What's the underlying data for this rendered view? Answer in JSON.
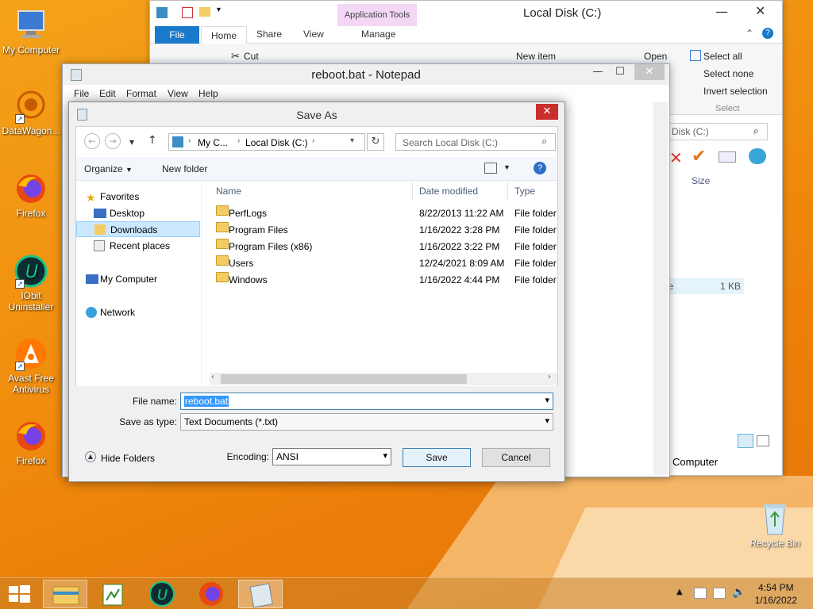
{
  "desktop": {
    "icons": [
      {
        "label": "My Computer"
      },
      {
        "label": "DataWagon..."
      },
      {
        "label": "Firefox"
      },
      {
        "label": "IObit Uninstaller"
      },
      {
        "label": "Avast Free Antivirus"
      },
      {
        "label": "Firefox"
      }
    ],
    "recycle_bin": "Recycle Bin"
  },
  "explorer": {
    "title": "Local Disk (C:)",
    "context_tab": "Application Tools",
    "tabs": [
      "File",
      "Home",
      "Share",
      "View",
      "Manage"
    ],
    "ribbon": {
      "cut": "Cut",
      "new_item": "New item",
      "open": "Open",
      "select_all": "Select all",
      "select_none": "Select none",
      "invert_selection": "Invert selection",
      "select_group": "Select"
    },
    "search_fragment": "Disk (C:)",
    "size_header": "Size",
    "size_value": "1 KB",
    "name_fragment": "le",
    "status_fragment": "Computer"
  },
  "notepad": {
    "title": "reboot.bat - Notepad",
    "menu": [
      "File",
      "Edit",
      "Format",
      "View",
      "Help"
    ]
  },
  "saveas": {
    "title": "Save As",
    "breadcrumb": [
      "My C...",
      "Local Disk (C:)"
    ],
    "search_placeholder": "Search Local Disk (C:)",
    "organize": "Organize",
    "new_folder": "New folder",
    "nav": {
      "favorites": "Favorites",
      "desktop": "Desktop",
      "downloads": "Downloads",
      "recent": "Recent places",
      "computer": "My Computer",
      "network": "Network"
    },
    "columns": [
      "Name",
      "Date modified",
      "Type"
    ],
    "files": [
      {
        "name": "PerfLogs",
        "date": "8/22/2013 11:22 AM",
        "type": "File folder"
      },
      {
        "name": "Program Files",
        "date": "1/16/2022 3:28 PM",
        "type": "File folder"
      },
      {
        "name": "Program Files (x86)",
        "date": "1/16/2022 3:22 PM",
        "type": "File folder"
      },
      {
        "name": "Users",
        "date": "12/24/2021 8:09 AM",
        "type": "File folder"
      },
      {
        "name": "Windows",
        "date": "1/16/2022 4:44 PM",
        "type": "File folder"
      }
    ],
    "file_name_label": "File name:",
    "file_name_value": "reboot.bat",
    "save_type_label": "Save as type:",
    "save_type_value": "Text Documents (*.txt)",
    "hide_folders": "Hide Folders",
    "encoding_label": "Encoding:",
    "encoding_value": "ANSI",
    "save_button": "Save",
    "cancel_button": "Cancel"
  },
  "taskbar": {
    "time": "4:54 PM",
    "date": "1/16/2022"
  }
}
